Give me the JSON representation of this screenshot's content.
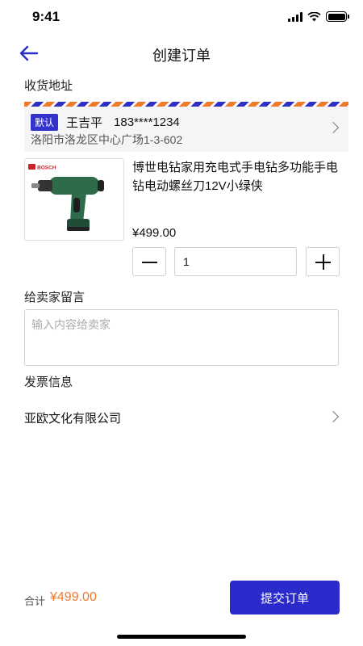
{
  "status_bar": {
    "time": "9:41"
  },
  "nav": {
    "title": "创建订单"
  },
  "address": {
    "section_title": "收货地址",
    "default_badge": "默认",
    "name": "王吉平",
    "phone": "183****1234",
    "detail": "洛阳市洛龙区中心广场1-3-602"
  },
  "product": {
    "title": "博世电钻家用充电式手电钻多功能手电钻电动螺丝刀12V小绿侠",
    "price": "¥499.00",
    "quantity": "1",
    "image_brand": "BOSCH"
  },
  "memo": {
    "section_title": "给卖家留言",
    "placeholder": "输入内容给卖家"
  },
  "invoice": {
    "section_title": "发票信息",
    "company": "亚欧文化有限公司"
  },
  "footer": {
    "total_label": "合计",
    "total_value": "¥499.00",
    "submit_label": "提交订单"
  },
  "colors": {
    "accent": "#2b2bcc",
    "price_orange": "#f07a2c",
    "drill_green": "#2e6b4a"
  }
}
